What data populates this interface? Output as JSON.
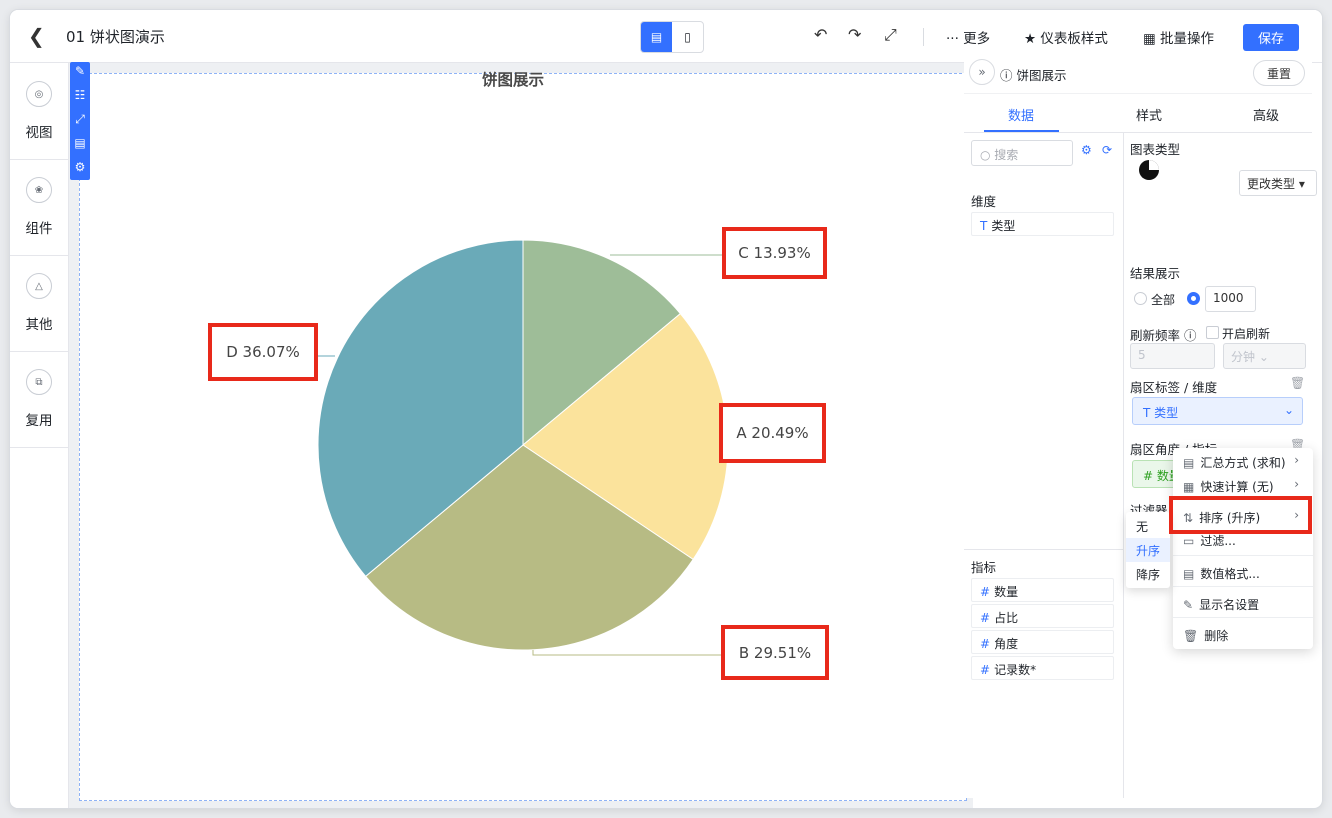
{
  "header": {
    "back_icon": "chevron-left-icon",
    "title": "01 饼状图演示",
    "more": "··· 更多",
    "style": "仪表板样式",
    "batch": "批量操作",
    "save": "保存"
  },
  "sidebar": {
    "items": [
      {
        "label": "视图",
        "icon": "view-icon"
      },
      {
        "label": "组件",
        "icon": "component-icon"
      },
      {
        "label": "其他",
        "icon": "other-icon"
      },
      {
        "label": "复用",
        "icon": "reuse-icon"
      }
    ]
  },
  "chart": {
    "title": "饼图展示",
    "highlight_color": "#e8291a"
  },
  "chart_data": {
    "type": "pie",
    "title": "饼图展示",
    "slices": [
      {
        "name": "C",
        "value": 13.93,
        "label": "C 13.93%",
        "color": "#9ebd98"
      },
      {
        "name": "A",
        "value": 20.49,
        "label": "A 20.49%",
        "color": "#fbe39c"
      },
      {
        "name": "B",
        "value": 29.51,
        "label": "B 29.51%",
        "color": "#b7bb84"
      },
      {
        "name": "D",
        "value": 36.07,
        "label": "D 36.07%",
        "color": "#6aaab8"
      }
    ]
  },
  "panel": {
    "name": "饼图展示",
    "reset": "重置",
    "tabs": [
      "数据",
      "样式",
      "高级"
    ],
    "search_placeholder": "搜索",
    "dimension_label": "维度",
    "dimension_field": "类型",
    "metric_label": "指标",
    "metrics": [
      "数量",
      "占比",
      "角度",
      "记录数*"
    ],
    "chart_type_label": "图表类型",
    "change_type": "更改类型",
    "result_label": "结果展示",
    "all": "全部",
    "limit": "1000",
    "refresh_label": "刷新频率",
    "auto_refresh": "开启刷新",
    "refresh_value": "5",
    "refresh_unit": "分钟",
    "sector_label": "扇区标签 / 维度",
    "sector_field": "类型",
    "angle_label": "扇区角度 / 指标",
    "angle_field": "数量",
    "angle_agg": "求和",
    "filter_label": "过滤器",
    "filter_field": "类",
    "accent": "#3370ff"
  },
  "context_menu": {
    "items": [
      {
        "icon": "summary-icon",
        "label": "汇总方式 (求和)",
        "arrow": true
      },
      {
        "icon": "quick-calc-icon",
        "label": "快速计算 (无)",
        "arrow": true
      },
      {
        "icon": "sort-icon",
        "label": "排序 (升序)",
        "arrow": true
      },
      {
        "icon": "filter-icon",
        "label": "过滤...",
        "arrow": false
      },
      {
        "icon": "number-format-icon",
        "label": "数值格式...",
        "arrow": false
      },
      {
        "icon": "rename-icon",
        "label": "显示名设置",
        "arrow": false
      },
      {
        "icon": "delete-icon",
        "label": "删除",
        "arrow": false
      }
    ]
  },
  "sort_submenu": {
    "items": [
      "无",
      "升序",
      "降序"
    ],
    "selected": "升序"
  }
}
